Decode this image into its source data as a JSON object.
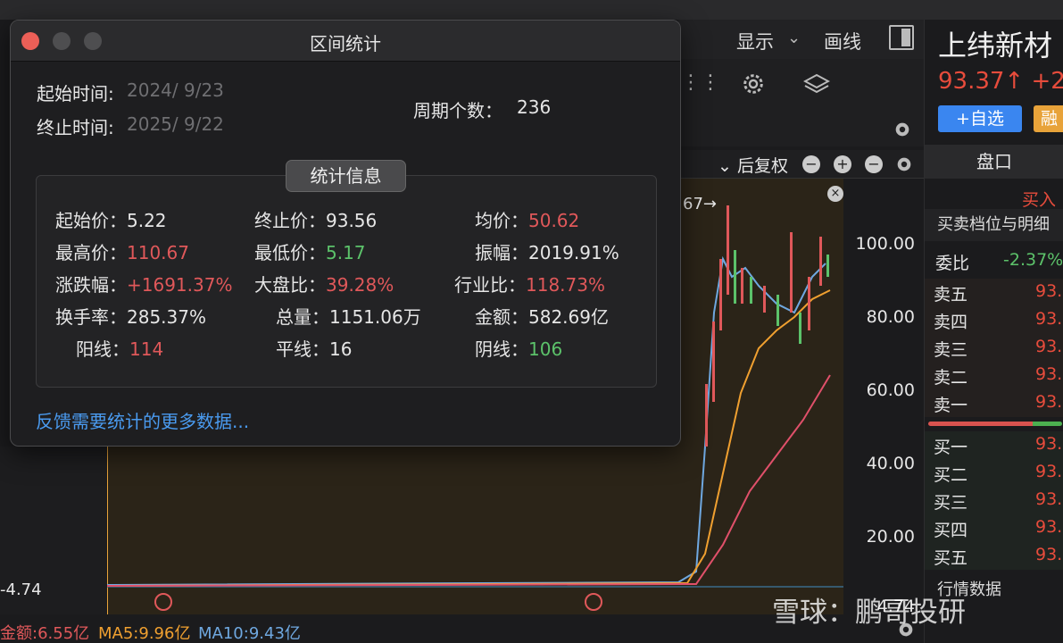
{
  "colors": {
    "up": "#e0585a",
    "down": "#5cc26a",
    "link": "#4a9bf0",
    "ma5": "#f0a030",
    "ma10": "#6fa8e0",
    "ma20": "#e0506a"
  },
  "toolbar": {
    "display": "显示",
    "draw": "画线",
    "fq": "后复权"
  },
  "axis": {
    "ticks": [
      "100.00",
      "80.00",
      "60.00",
      "40.00",
      "20.00"
    ],
    "low_label": "4.74",
    "left_label": "-4.74",
    "top_arrow": "67→"
  },
  "bottom": {
    "amount": "金额:6.55亿",
    "ma5": "MA5:9.96亿",
    "ma10": "MA10:9.43亿"
  },
  "right_panel": {
    "name": "上纬新材",
    "price": "93.37↑ +2",
    "add_watch": "+自选",
    "rong": "融",
    "pankou": "盘口",
    "buyin": "买入",
    "mmdw": "买卖档位与明细",
    "weibi_label": "委比",
    "weibi_value": "-2.37%",
    "sell": [
      {
        "k": "卖五",
        "v": "93."
      },
      {
        "k": "卖四",
        "v": "93."
      },
      {
        "k": "卖三",
        "v": "93."
      },
      {
        "k": "卖二",
        "v": "93."
      },
      {
        "k": "卖一",
        "v": "93."
      }
    ],
    "buy": [
      {
        "k": "买一",
        "v": "93."
      },
      {
        "k": "买二",
        "v": "93."
      },
      {
        "k": "买三",
        "v": "93."
      },
      {
        "k": "买四",
        "v": "93."
      },
      {
        "k": "买五",
        "v": "93."
      }
    ],
    "hq": "行情数据"
  },
  "watermark": "雪球：鹏哥投研",
  "dialog": {
    "title": "区间统计",
    "start_label": "起始时间:",
    "start_value": "2024/  9/23",
    "end_label": "终止时间:",
    "end_value": "2025/  9/22",
    "period_label": "周期个数：",
    "period_value": "236",
    "section": "统计信息",
    "stats": {
      "start_price": {
        "k": "起始价：",
        "v": "5.22"
      },
      "end_price": {
        "k": "终止价：",
        "v": "93.56"
      },
      "avg": {
        "k": "均价：",
        "v": "50.62"
      },
      "high": {
        "k": "最高价：",
        "v": "110.67"
      },
      "low": {
        "k": "最低价：",
        "v": "5.17"
      },
      "amp": {
        "k": "振幅：",
        "v": "2019.91%"
      },
      "chg": {
        "k": "涨跌幅：",
        "v": "+1691.37%"
      },
      "vs_market": {
        "k": "大盘比：",
        "v": "39.28%"
      },
      "vs_industry": {
        "k": "行业比：",
        "v": "118.73%"
      },
      "turnover": {
        "k": "换手率：",
        "v": "285.37%"
      },
      "volume": {
        "k": "总量：",
        "v": "1151.06万"
      },
      "amount": {
        "k": "金额：",
        "v": "582.69亿"
      },
      "up_days": {
        "k": "阳线：",
        "v": "114"
      },
      "flat_days": {
        "k": "平线：",
        "v": "16"
      },
      "down_days": {
        "k": "阴线：",
        "v": "106"
      }
    },
    "feedback": "反馈需要统计的更多数据..."
  }
}
